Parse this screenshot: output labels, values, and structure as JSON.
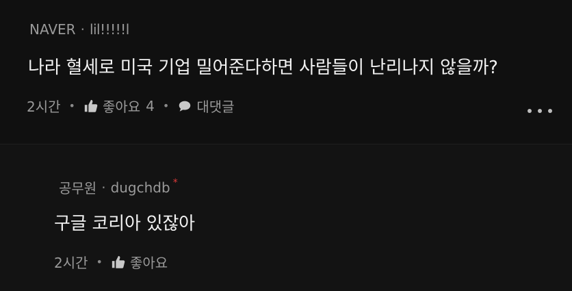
{
  "comment": {
    "source": "NAVER",
    "author": "lil!!!!!l",
    "text": "나라 혈세로 미국 기업 밀어준다하면 사람들이 난리나지 않을까?",
    "time": "2시간",
    "like_label": "좋아요",
    "like_count": "4",
    "reply_label": "대댓글",
    "more_icon": "more-horizontal-icon"
  },
  "reply": {
    "source": "공무원",
    "author": "dugchdb",
    "badge": "*",
    "text": "구글 코리아 있잖아",
    "time": "2시간",
    "like_label": "좋아요"
  },
  "colors": {
    "background": "#0f0f0f",
    "text": "#f2f2f2",
    "muted": "#9a9a9a",
    "badge": "#e03a3a"
  }
}
